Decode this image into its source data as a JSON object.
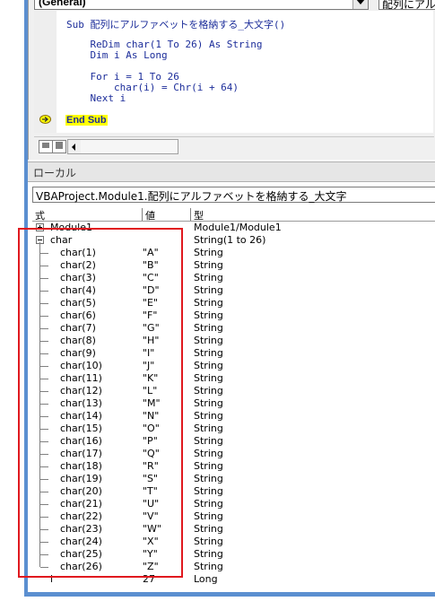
{
  "code_window": {
    "object_combo": "(General)",
    "procedure_combo": "配列にアルファベットを格納する_大文字()",
    "lines": [
      "Sub 配列にアルファベットを格納する_大文字()",
      "    ReDim char(1 To 26) As String",
      "    Dim i As Long",
      "    For i = 1 To 26",
      "        char(i) = Chr(i + 64)",
      "    Next i",
      "End Sub"
    ]
  },
  "locals": {
    "title": "ローカル",
    "context": "VBAProject.Module1.配列にアルファベットを格納する_大文字",
    "headers": {
      "expr": "式",
      "value": "値",
      "type": "型"
    },
    "rows": [
      {
        "expr": "Module1",
        "value": "",
        "type": "Module1/Module1"
      },
      {
        "expr": "char",
        "value": "",
        "type": "String(1 to 26)"
      },
      {
        "expr": "char(1)",
        "value": "\"A\"",
        "type": "String"
      },
      {
        "expr": "char(2)",
        "value": "\"B\"",
        "type": "String"
      },
      {
        "expr": "char(3)",
        "value": "\"C\"",
        "type": "String"
      },
      {
        "expr": "char(4)",
        "value": "\"D\"",
        "type": "String"
      },
      {
        "expr": "char(5)",
        "value": "\"E\"",
        "type": "String"
      },
      {
        "expr": "char(6)",
        "value": "\"F\"",
        "type": "String"
      },
      {
        "expr": "char(7)",
        "value": "\"G\"",
        "type": "String"
      },
      {
        "expr": "char(8)",
        "value": "\"H\"",
        "type": "String"
      },
      {
        "expr": "char(9)",
        "value": "\"I\"",
        "type": "String"
      },
      {
        "expr": "char(10)",
        "value": "\"J\"",
        "type": "String"
      },
      {
        "expr": "char(11)",
        "value": "\"K\"",
        "type": "String"
      },
      {
        "expr": "char(12)",
        "value": "\"L\"",
        "type": "String"
      },
      {
        "expr": "char(13)",
        "value": "\"M\"",
        "type": "String"
      },
      {
        "expr": "char(14)",
        "value": "\"N\"",
        "type": "String"
      },
      {
        "expr": "char(15)",
        "value": "\"O\"",
        "type": "String"
      },
      {
        "expr": "char(16)",
        "value": "\"P\"",
        "type": "String"
      },
      {
        "expr": "char(17)",
        "value": "\"Q\"",
        "type": "String"
      },
      {
        "expr": "char(18)",
        "value": "\"R\"",
        "type": "String"
      },
      {
        "expr": "char(19)",
        "value": "\"S\"",
        "type": "String"
      },
      {
        "expr": "char(20)",
        "value": "\"T\"",
        "type": "String"
      },
      {
        "expr": "char(21)",
        "value": "\"U\"",
        "type": "String"
      },
      {
        "expr": "char(22)",
        "value": "\"V\"",
        "type": "String"
      },
      {
        "expr": "char(23)",
        "value": "\"W\"",
        "type": "String"
      },
      {
        "expr": "char(24)",
        "value": "\"X\"",
        "type": "String"
      },
      {
        "expr": "char(25)",
        "value": "\"Y\"",
        "type": "String"
      },
      {
        "expr": "char(26)",
        "value": "\"Z\"",
        "type": "String"
      },
      {
        "expr": "i",
        "value": "27",
        "type": "Long"
      }
    ]
  },
  "colors": {
    "highlight_box": "#e0191f",
    "execution_line": "#ffff00",
    "code_text": "#1c2d9a"
  }
}
